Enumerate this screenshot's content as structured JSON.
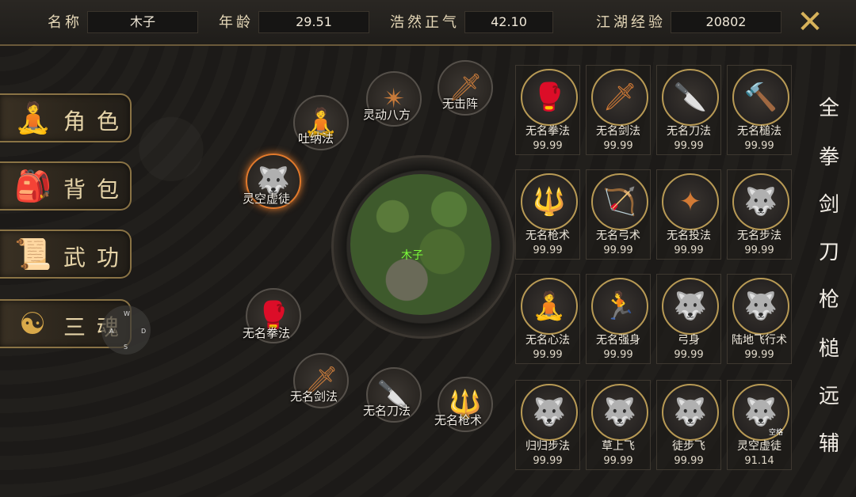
{
  "top": {
    "name_label": "名称",
    "name_value": "木子",
    "age_label": "年龄",
    "age_value": "29.51",
    "qi_label": "浩然正气",
    "qi_value": "42.10",
    "exp_label": "江湖经验",
    "exp_value": "20802",
    "close": "✕"
  },
  "menu": [
    {
      "label": "角色",
      "icon": "🧘"
    },
    {
      "label": "背包",
      "icon": "🎒"
    },
    {
      "label": "武功",
      "icon": "📜"
    },
    {
      "label": "三魂",
      "icon": "☯"
    }
  ],
  "joystick": {
    "w": "W",
    "a": "A",
    "s": "S",
    "d": "D"
  },
  "minimap": {
    "player": "木子"
  },
  "orbs": [
    {
      "label": "吐纳法",
      "glyph": "🧘"
    },
    {
      "label": "灵动八方",
      "glyph": "✴"
    },
    {
      "label": "无击阵",
      "glyph": "🗡"
    },
    {
      "label": "灵空虚徒",
      "glyph": "🐺"
    },
    {
      "label": "无名拳法",
      "glyph": "🥊"
    },
    {
      "label": "无名剑法",
      "glyph": "🗡"
    },
    {
      "label": "无名刀法",
      "glyph": "🔪"
    },
    {
      "label": "无名枪术",
      "glyph": "🔱"
    }
  ],
  "grid": [
    {
      "name": "无名拳法",
      "val": "99.99",
      "glyph": "🥊"
    },
    {
      "name": "无名剑法",
      "val": "99.99",
      "glyph": "🗡"
    },
    {
      "name": "无名刀法",
      "val": "99.99",
      "glyph": "🔪"
    },
    {
      "name": "无名槌法",
      "val": "99.99",
      "glyph": "🔨"
    },
    {
      "name": "无名枪术",
      "val": "99.99",
      "glyph": "🔱"
    },
    {
      "name": "无名弓术",
      "val": "99.99",
      "glyph": "🏹"
    },
    {
      "name": "无名投法",
      "val": "99.99",
      "glyph": "✦"
    },
    {
      "name": "无名步法",
      "val": "99.99",
      "glyph": "🐺"
    },
    {
      "name": "无名心法",
      "val": "99.99",
      "glyph": "🧘"
    },
    {
      "name": "无名强身",
      "val": "99.99",
      "glyph": "🏃"
    },
    {
      "name": "弓身",
      "val": "99.99",
      "glyph": "🐺"
    },
    {
      "name": "陆地飞行术",
      "val": "99.99",
      "glyph": "🐺"
    },
    {
      "name": "归归步法",
      "val": "99.99",
      "glyph": "🐺"
    },
    {
      "name": "草上飞",
      "val": "99.99",
      "glyph": "🐺"
    },
    {
      "name": "徒步飞",
      "val": "99.99",
      "glyph": "🐺"
    },
    {
      "name": "灵空虚徒",
      "val": "91.14",
      "glyph": "🐺",
      "tag": "空格"
    }
  ],
  "categories": [
    "全",
    "拳",
    "剑",
    "刀",
    "枪",
    "槌",
    "远",
    "辅"
  ]
}
